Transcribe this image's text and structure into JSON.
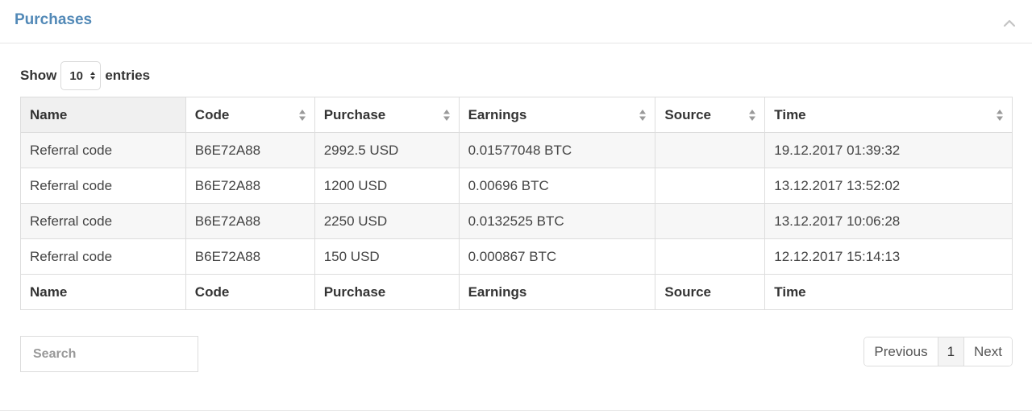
{
  "panel": {
    "title": "Purchases"
  },
  "length_menu": {
    "show_label": "Show",
    "selected": "10",
    "entries_label": "entries"
  },
  "table": {
    "columns": [
      "Name",
      "Code",
      "Purchase",
      "Earnings",
      "Source",
      "Time"
    ],
    "rows": [
      [
        "Referral code",
        "B6E72A88",
        "2992.5 USD",
        "0.01577048 BTC",
        "",
        "19.12.2017 01:39:32"
      ],
      [
        "Referral code",
        "B6E72A88",
        "1200 USD",
        "0.00696 BTC",
        "",
        "13.12.2017 13:52:02"
      ],
      [
        "Referral code",
        "B6E72A88",
        "2250 USD",
        "0.0132525 BTC",
        "",
        "13.12.2017 10:06:28"
      ],
      [
        "Referral code",
        "B6E72A88",
        "150 USD",
        "0.000867 BTC",
        "",
        "12.12.2017 15:14:13"
      ]
    ]
  },
  "search": {
    "placeholder": "Search"
  },
  "pagination": {
    "previous": "Previous",
    "current": "1",
    "next": "Next"
  },
  "icons": {
    "collapse": "chevron-up-icon",
    "sort": "sort-icon",
    "select_arrows": "select-arrows-icon"
  },
  "colors": {
    "title": "#5289b7",
    "sorted_header_bg": "#f0f0f0",
    "striped_row_bg": "#f7f7f7"
  }
}
